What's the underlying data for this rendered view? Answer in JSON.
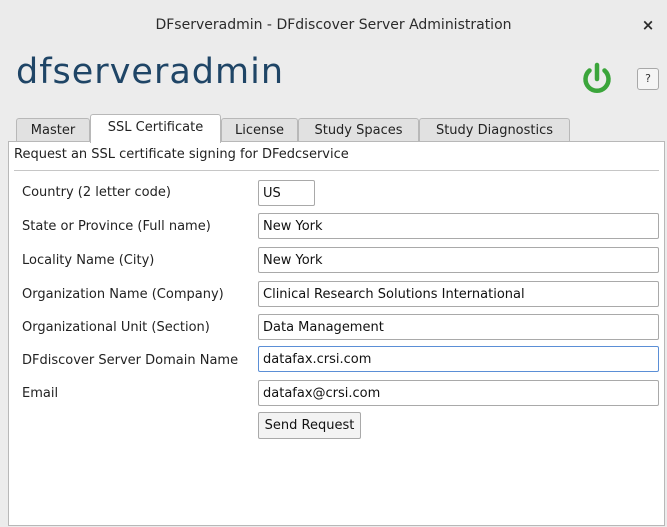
{
  "window": {
    "title": "DFserveradmin - DFdiscover Server Administration",
    "close_glyph": "×"
  },
  "app": {
    "title": "dfserveradmin",
    "power_icon": "power-icon",
    "help_label": "?",
    "accent_color": "#3ba53b"
  },
  "tabs": [
    {
      "label": "Master",
      "active": false
    },
    {
      "label": "SSL Certificate",
      "active": true
    },
    {
      "label": "License",
      "active": false
    },
    {
      "label": "Study Spaces",
      "active": false
    },
    {
      "label": "Study Diagnostics",
      "active": false
    }
  ],
  "form": {
    "heading": "Request an SSL certificate signing for DFedcservice",
    "fields": [
      {
        "label": "Country (2 letter code)",
        "value": "US"
      },
      {
        "label": "State or Province (Full name)",
        "value": "New York"
      },
      {
        "label": "Locality Name (City)",
        "value": "New York"
      },
      {
        "label": "Organization Name (Company)",
        "value": "Clinical Research Solutions International"
      },
      {
        "label": "Organizational Unit (Section)",
        "value": "Data Management"
      },
      {
        "label": "DFdiscover Server Domain Name",
        "value": "datafax.crsi.com"
      },
      {
        "label": "Email",
        "value": "datafax@crsi.com"
      }
    ],
    "submit_label": "Send Request"
  }
}
